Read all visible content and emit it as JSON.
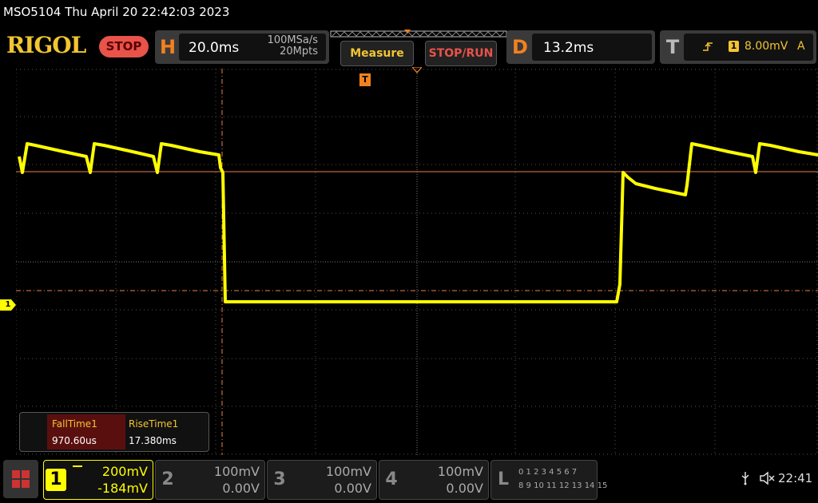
{
  "title": "MSO5104  Thu April 20 22:42:03 2023",
  "logo": "RIGOL",
  "run_state": "STOP",
  "horizontal": {
    "letter": "H",
    "timebase": "20.0ms",
    "sample_rate": "100MSa/s",
    "memory": "20Mpts"
  },
  "buttons": {
    "measure": "Measure",
    "stop_run": "STOP/RUN"
  },
  "delay": {
    "letter": "D",
    "value": "13.2ms"
  },
  "trigger": {
    "letter": "T",
    "source": "1",
    "level": "8.00mV",
    "mode": "A"
  },
  "trigger_marker": "T",
  "channel1_marker": "1",
  "measurements": [
    {
      "label": "FallTime1",
      "value": "970.60us"
    },
    {
      "label": "RiseTime1",
      "value": "17.380ms"
    }
  ],
  "channels": [
    {
      "num": "1",
      "scale": "200mV",
      "offset": "-184mV",
      "active": true
    },
    {
      "num": "2",
      "scale": "100mV",
      "offset": "0.00V",
      "active": false
    },
    {
      "num": "3",
      "scale": "100mV",
      "offset": "0.00V",
      "active": false
    },
    {
      "num": "4",
      "scale": "100mV",
      "offset": "0.00V",
      "active": false
    }
  ],
  "logic": {
    "letter": "L",
    "row1": "0 1 2 3  4 5 6 7",
    "row2": "8 9 10 11 12 13 14 15"
  },
  "status": {
    "time": "22:41"
  },
  "colors": {
    "trace": "#ffff00",
    "accent": "#f2811e",
    "cursor": "#e8834a",
    "logo": "#f2c531",
    "stop": "#e8534a"
  }
}
